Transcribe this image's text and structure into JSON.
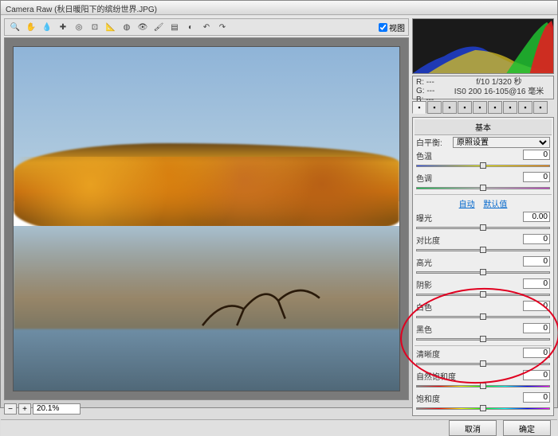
{
  "title": "Camera Raw (秋日暖阳下的缤纷世界.JPG)",
  "preview_label": "视图",
  "zoom_value": "20.1%",
  "exif": {
    "r": "R: ---",
    "g": "G: ---",
    "b": "B: ---",
    "line1": "f/10  1/320 秒",
    "line2": "IS0 200  16-105@16 毫米"
  },
  "panel_title": "基本",
  "white_balance": {
    "label": "白平衡:",
    "value": "原照设置"
  },
  "links": {
    "auto": "自动",
    "default": "默认值"
  },
  "sliders": {
    "temp": {
      "label": "色温",
      "value": "0",
      "pos": 50,
      "track": "temp"
    },
    "tint": {
      "label": "色调",
      "value": "0",
      "pos": 50,
      "track": "tint"
    },
    "exposure": {
      "label": "曝光",
      "value": "0.00",
      "pos": 50,
      "track": ""
    },
    "contrast": {
      "label": "对比度",
      "value": "0",
      "pos": 50,
      "track": ""
    },
    "highlights": {
      "label": "高光",
      "value": "0",
      "pos": 50,
      "track": ""
    },
    "shadows": {
      "label": "阴影",
      "value": "0",
      "pos": 50,
      "track": ""
    },
    "whites": {
      "label": "白色",
      "value": "0",
      "pos": 50,
      "track": ""
    },
    "blacks": {
      "label": "黑色",
      "value": "0",
      "pos": 50,
      "track": ""
    },
    "clarity": {
      "label": "清晰度",
      "value": "0",
      "pos": 50,
      "track": ""
    },
    "vibrance": {
      "label": "自然饱和度",
      "value": "0",
      "pos": 50,
      "track": "vib"
    },
    "saturation": {
      "label": "饱和度",
      "value": "0",
      "pos": 50,
      "track": "vib"
    }
  },
  "buttons": {
    "cancel": "取消",
    "ok": "确定"
  },
  "tools": [
    "zoom-icon",
    "hand-icon",
    "wb-icon",
    "sampler-icon",
    "target-icon",
    "crop-icon",
    "straighten-icon",
    "spot-icon",
    "redeye-icon",
    "adjust-icon",
    "grad-icon",
    "radial-icon",
    "rotate-ccw-icon",
    "rotate-cw-icon"
  ],
  "tool_glyphs": [
    "🔍",
    "✋",
    "💧",
    "✚",
    "◎",
    "⊡",
    "📐",
    "◍",
    "👁",
    "🖌",
    "▤",
    "◐",
    "↶",
    "↷"
  ],
  "tabs": [
    "basic-tab",
    "curve-tab",
    "detail-tab",
    "hsl-tab",
    "split-tab",
    "lens-tab",
    "fx-tab",
    "cal-tab",
    "preset-tab"
  ]
}
